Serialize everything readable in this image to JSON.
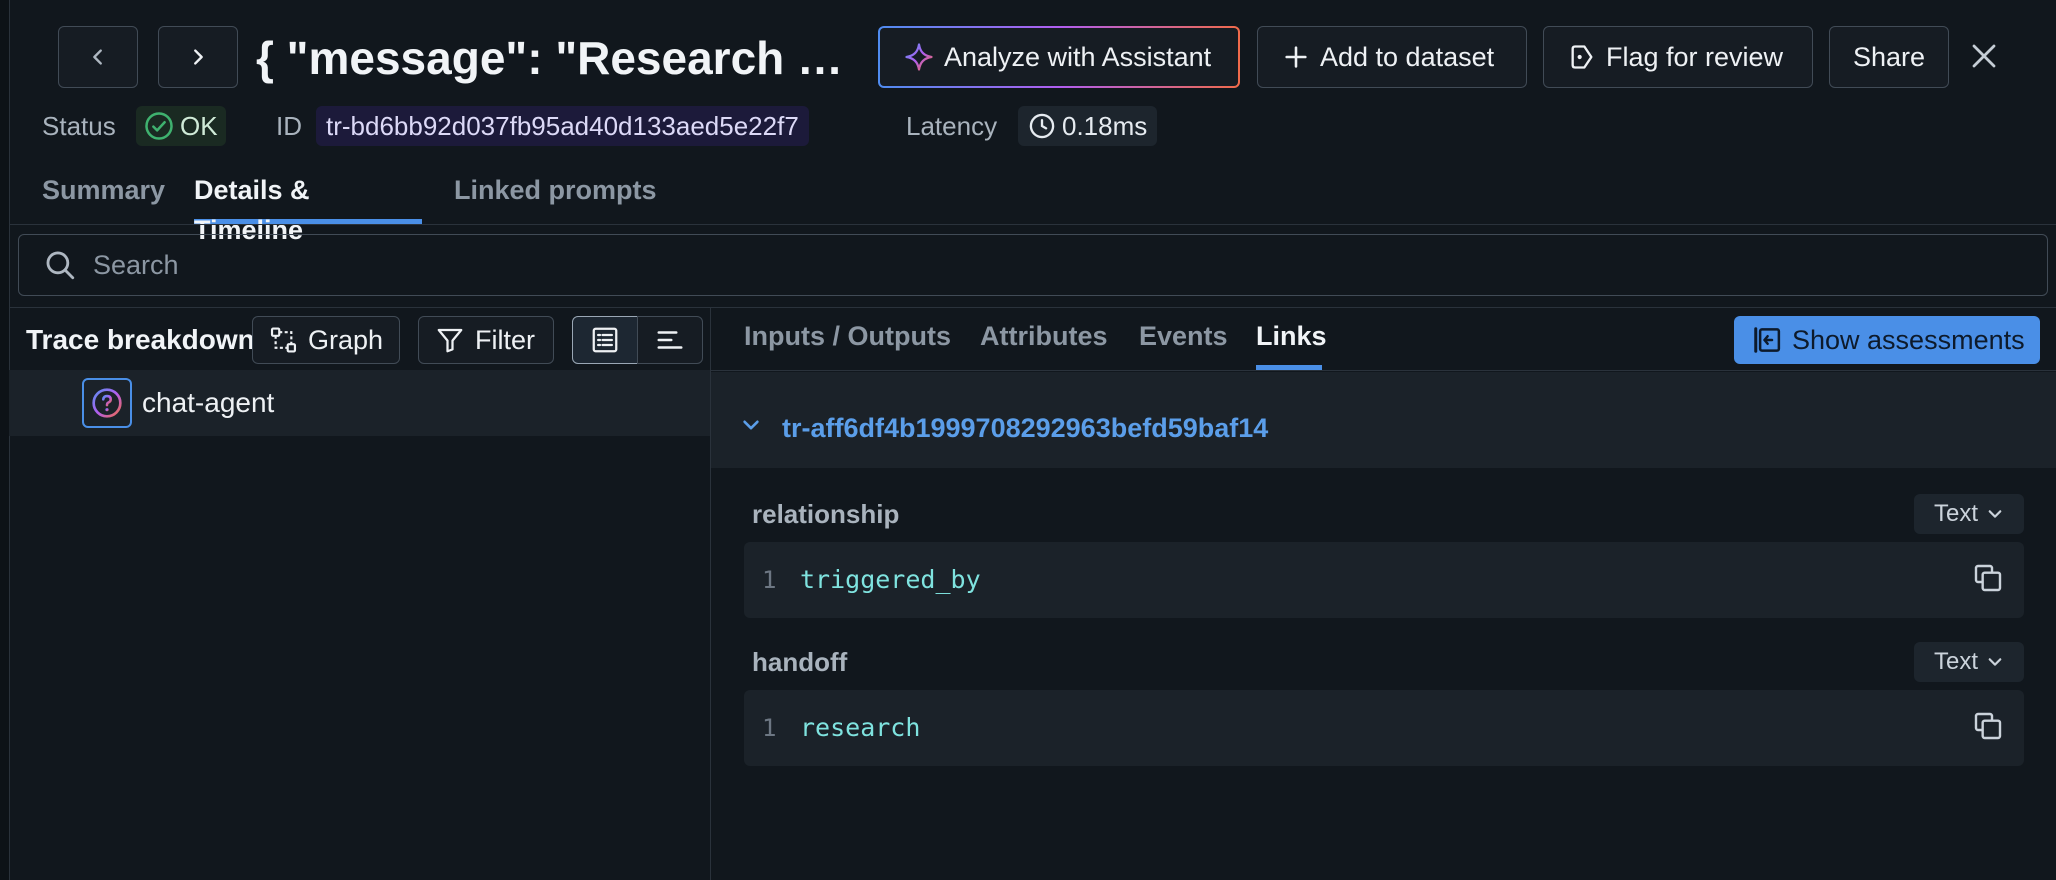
{
  "header": {
    "title": "{ \"message\": \"Research this...",
    "buttons": {
      "analyze": "Analyze with Assistant",
      "add_dataset": "Add to dataset",
      "flag": "Flag for review",
      "share": "Share"
    }
  },
  "meta": {
    "status_label": "Status",
    "status_value": "OK",
    "id_label": "ID",
    "id_value": "tr-bd6bb92d037fb95ad40d133aed5e22f7",
    "latency_label": "Latency",
    "latency_value": "0.18ms"
  },
  "tabs": [
    "Summary",
    "Details & Timeline",
    "Linked prompts"
  ],
  "search": {
    "placeholder": "Search"
  },
  "trace": {
    "title": "Trace breakdown",
    "graph_label": "Graph",
    "filter_label": "Filter",
    "nodes": [
      {
        "label": "chat-agent"
      }
    ]
  },
  "detail_tabs": [
    "Inputs / Outputs",
    "Attributes",
    "Events",
    "Links"
  ],
  "assessments_label": "Show assessments",
  "link": {
    "trace_id": "tr-aff6df4b1999708292963befd59baf14",
    "fields": [
      {
        "name": "relationship",
        "format": "Text",
        "line": "1",
        "value": "triggered_by"
      },
      {
        "name": "handoff",
        "format": "Text",
        "line": "1",
        "value": "research"
      }
    ]
  },
  "colors": {
    "accent": "#4a8fe7",
    "ok": "#3fb26f",
    "code": "#7fe3df"
  }
}
